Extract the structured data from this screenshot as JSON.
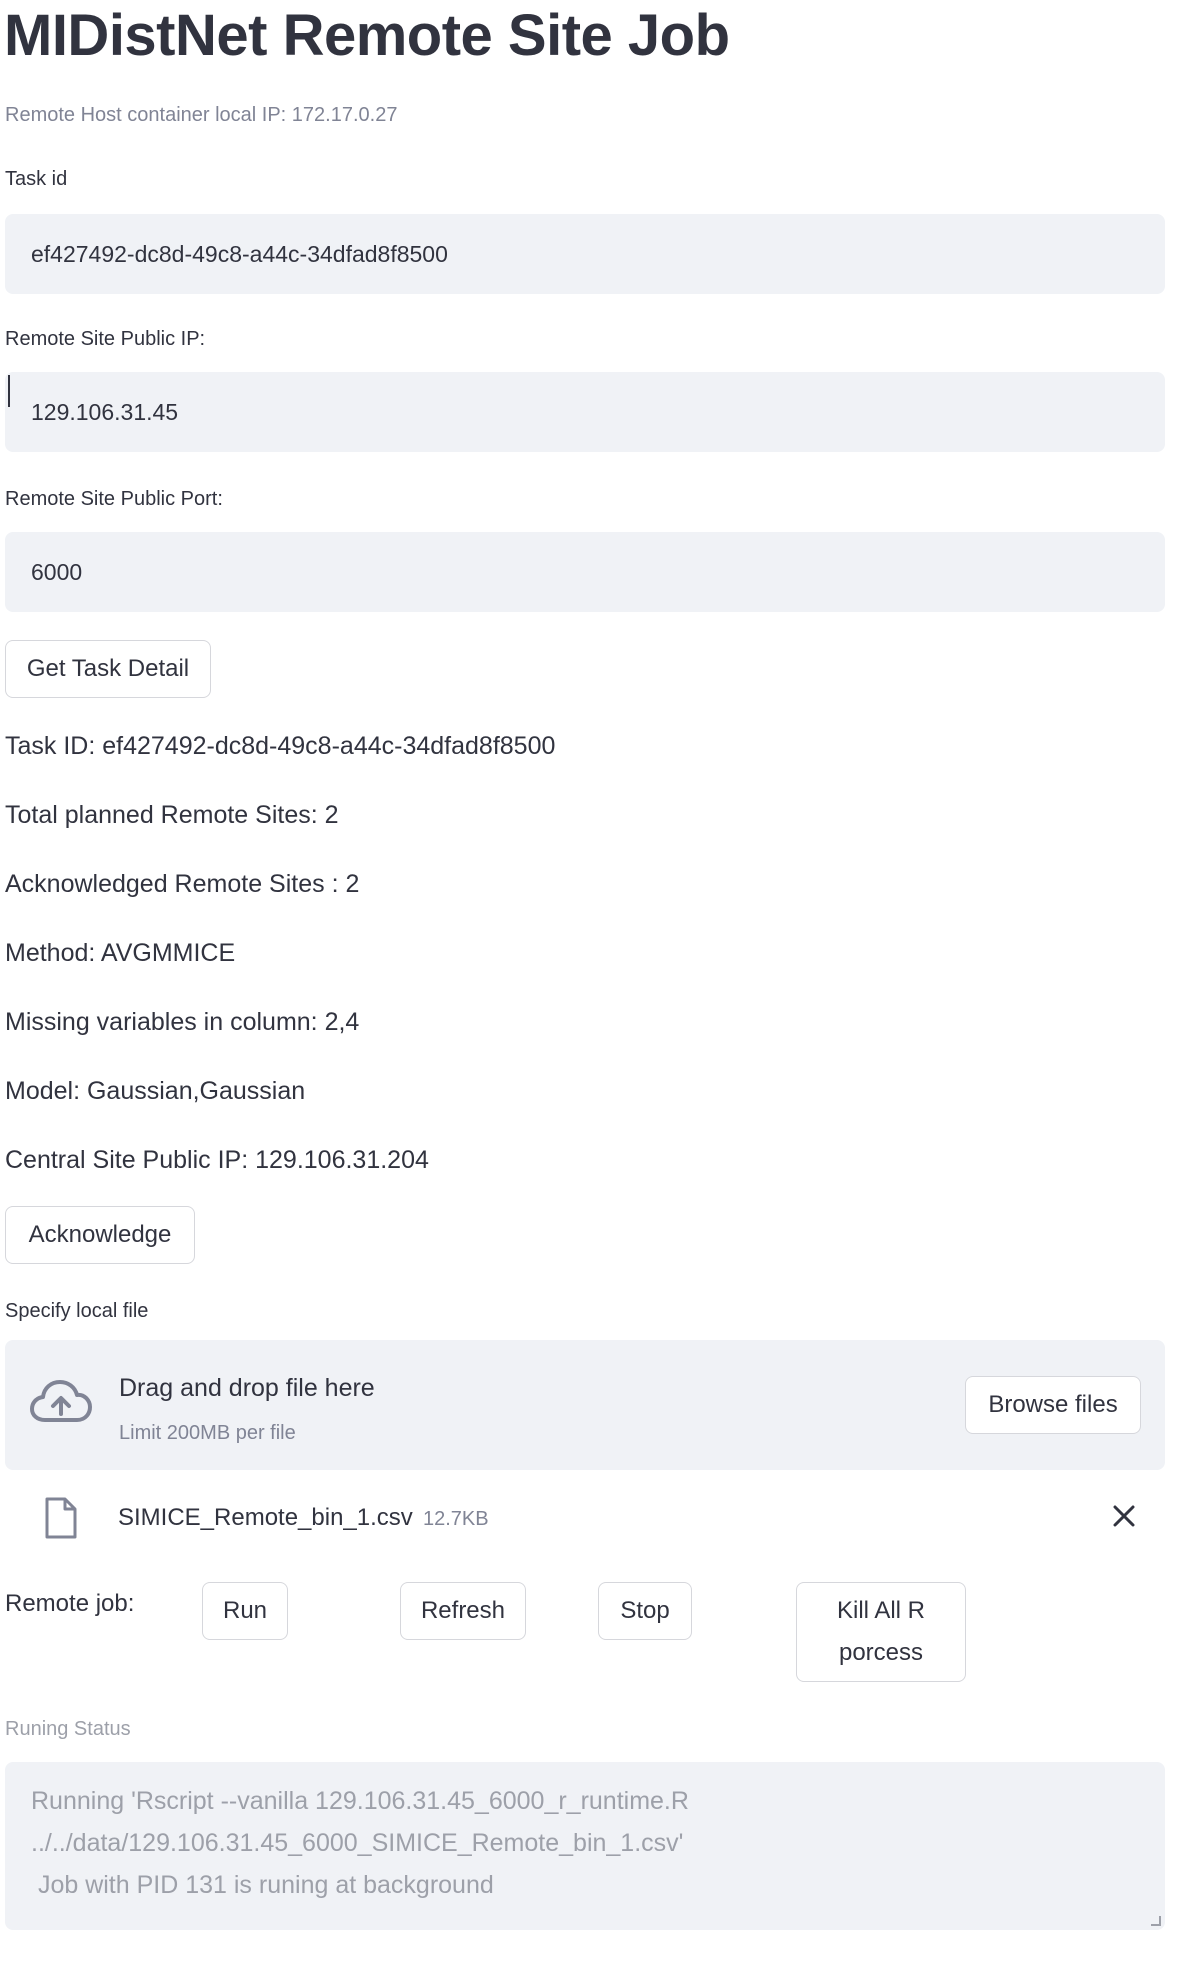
{
  "header": {
    "title": "MIDistNet Remote Site Job",
    "caption": "Remote Host container local IP: 172.17.0.27"
  },
  "fields": {
    "task_id_label": "Task id",
    "task_id_value": "ef427492-dc8d-49c8-a44c-34dfad8f8500",
    "public_ip_label": "Remote Site Public IP:",
    "public_ip_value": "129.106.31.45",
    "public_port_label": "Remote Site Public Port:",
    "public_port_value": "6000"
  },
  "buttons": {
    "get_task_detail": "Get Task Detail",
    "acknowledge": "Acknowledge",
    "browse_files": "Browse files",
    "run": "Run",
    "refresh": "Refresh",
    "stop": "Stop",
    "kill_line1": "Kill All R",
    "kill_line2": "porcess"
  },
  "task_details": [
    "Task ID: ef427492-dc8d-49c8-a44c-34dfad8f8500",
    "Total planned Remote Sites: 2",
    "Acknowledged Remote Sites : 2",
    "Method: AVGMMICE",
    "Missing variables in column: 2,4",
    "Model: Gaussian,Gaussian",
    "Central Site Public IP: 129.106.31.204"
  ],
  "uploader": {
    "label": "Specify local file",
    "drop_text": "Drag and drop file here",
    "limit_text": "Limit 200MB per file",
    "file_name": "SIMICE_Remote_bin_1.csv",
    "file_size": "12.7KB"
  },
  "remote_job": {
    "label": "Remote job:"
  },
  "status": {
    "label": "Runing Status",
    "lines": [
      "Running 'Rscript --vanilla 129.106.31.45_6000_r_runtime.R",
      "../../data/129.106.31.45_6000_SIMICE_Remote_bin_1.csv'",
      " Job with PID 131 is runing at background"
    ]
  },
  "icons": {
    "upload": "cloud-upload-icon",
    "file": "file-icon",
    "close": "close-icon"
  },
  "colors": {
    "input_bg": "#f0f2f6",
    "text": "#31333f",
    "muted": "#808495",
    "border": "#d6d7dc"
  }
}
